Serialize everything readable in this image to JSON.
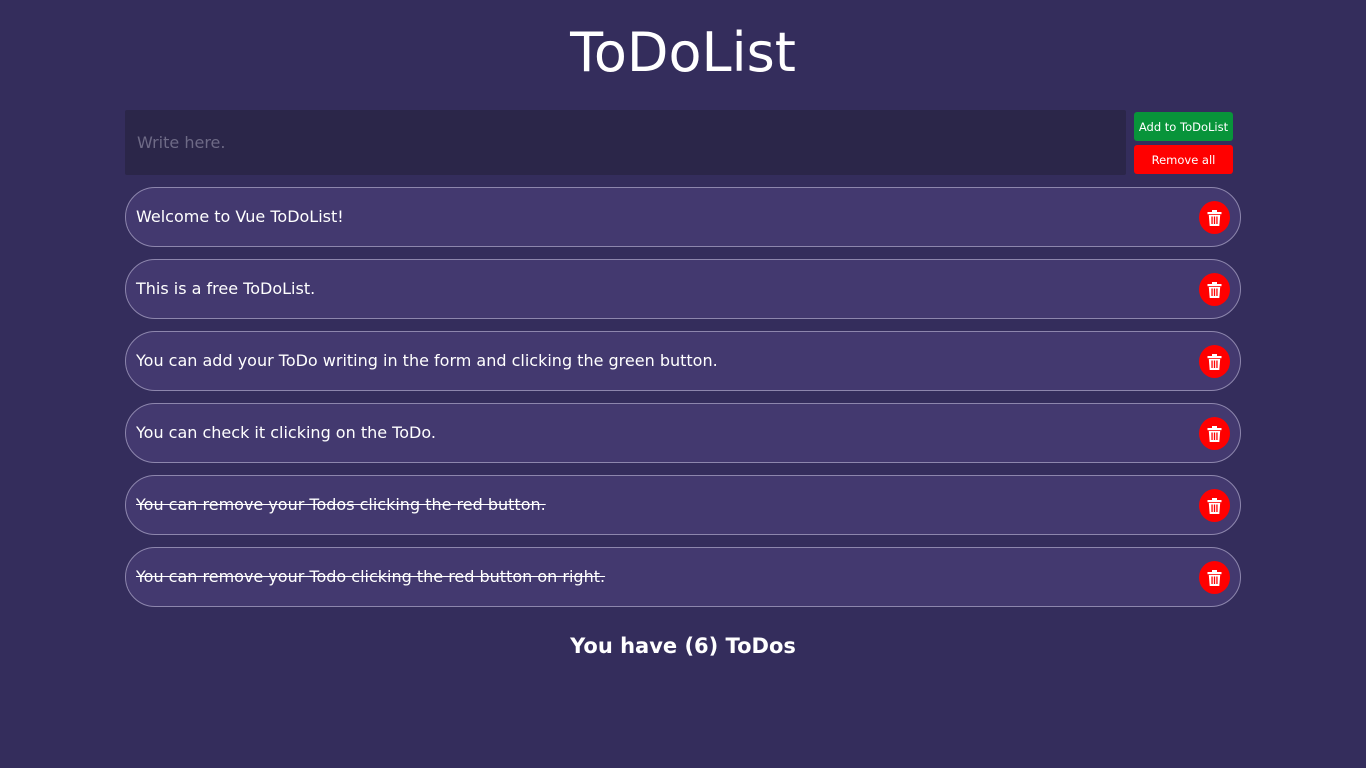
{
  "app": {
    "title": "ToDoList"
  },
  "form": {
    "placeholder": "Write here.",
    "value": "",
    "add_label": "Add to ToDoList",
    "remove_all_label": "Remove all"
  },
  "todos": [
    {
      "text": "Welcome to Vue ToDoList!",
      "done": false
    },
    {
      "text": "This is a free ToDoList.",
      "done": false
    },
    {
      "text": "You can add your ToDo writing in the form and clicking the green button.",
      "done": false
    },
    {
      "text": "You can check it clicking on the ToDo.",
      "done": false
    },
    {
      "text": "You can remove your Todos clicking the red button.",
      "done": true
    },
    {
      "text": "You can remove your Todo clicking the red button on right.",
      "done": true
    }
  ],
  "todo_delete_icon": "trash-icon",
  "footer": {
    "count_text": "You have (6) ToDos"
  },
  "colors": {
    "background": "#342d5c",
    "item_background": "#43396f",
    "input_background": "#2b2649",
    "add_button": "#08943a",
    "remove_button": "#ff0000"
  }
}
